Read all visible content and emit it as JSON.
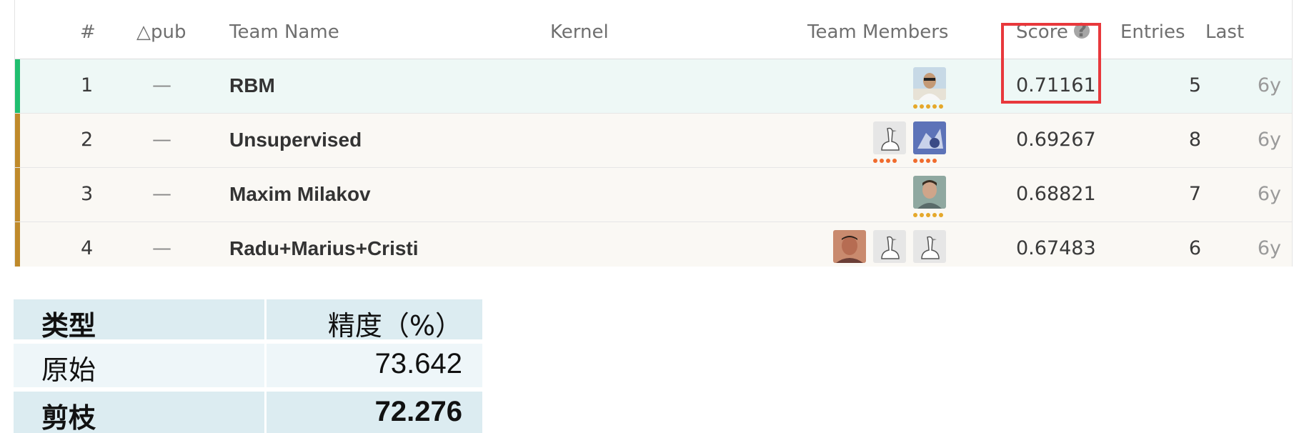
{
  "leaderboard": {
    "headers": {
      "rank": "#",
      "pub_delta": "△pub",
      "team_name": "Team Name",
      "kernel": "Kernel",
      "team_members": "Team Members",
      "score": "Score",
      "entries": "Entries",
      "last": "Last"
    },
    "rows": [
      {
        "rank": "1",
        "pub_change": "—",
        "team": "RBM",
        "score": "0.71161",
        "entries": "5",
        "last": "6y"
      },
      {
        "rank": "2",
        "pub_change": "—",
        "team": "Unsupervised",
        "score": "0.69267",
        "entries": "8",
        "last": "6y"
      },
      {
        "rank": "3",
        "pub_change": "—",
        "team": "Maxim Milakov",
        "score": "0.68821",
        "entries": "7",
        "last": "6y"
      },
      {
        "rank": "4",
        "pub_change": "—",
        "team": "Radu+Marius+Cristi",
        "score": "0.67483",
        "entries": "6",
        "last": "6y"
      }
    ],
    "colors": {
      "first_place": "#20be6f",
      "gold_bar": "#bf8a2b",
      "highlight": "#e8383c",
      "tier_gold": "#e5a82a",
      "tier_orange": "#f06b2d"
    }
  },
  "precision_table": {
    "header": {
      "type": "类型",
      "precision": "精度（%）"
    },
    "rows": [
      {
        "type": "原始",
        "precision": "73.642"
      },
      {
        "type": "剪枝",
        "precision": "72.276"
      }
    ]
  }
}
